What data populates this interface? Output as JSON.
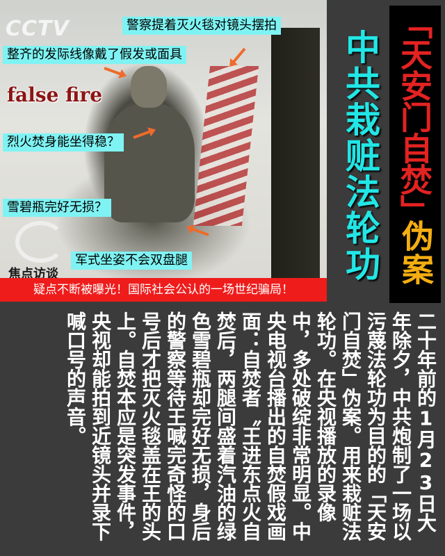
{
  "photo": {
    "logo_text": "CCTV",
    "false_fire": "false fire",
    "corner_text": "焦点访谈"
  },
  "captions": {
    "c1": "警察提着灭火毯对镜头摆拍",
    "c2": "整齐的发际线像戴了假发或面具",
    "c3": "烈火焚身能坐得稳？",
    "c4": "雪碧瓶完好无损？",
    "c5": "军式坐姿不会双盘腿"
  },
  "banner": "疑点不断被曝光！国际社会公认的一场世纪骗局！",
  "titles": {
    "cyan": "中共栽赃法轮功",
    "red": "「天安门自焚」",
    "yellow": "伪案"
  },
  "body": "二十年前的1月23日大年除夕，中共炮制了一场以污蔑法轮功为目的的「天安门自焚」伪案。用来栽赃法轮功。在央视播放的录像中，多处破绽非常明显。中央电视台播出的自焚假戏画面：自焚者〝王进东点火自焚后，两腿间盛着汽油的绿色雪碧瓶却完好无损，身后的警察等待王喊完奇怪的口号后才把灭火毯盖在王的头上。自焚本应是突发事件，央视却能拍到近镜头并录下喊口号的声音。",
  "colors": {
    "cyan_title": "#22e6e6",
    "red_title": "#e32222",
    "yellow_title": "#f5ae12",
    "caption_bg": "#7ff3f3",
    "banner_bg": "#ef1c1c",
    "page_bg": "#3b3b3b"
  }
}
